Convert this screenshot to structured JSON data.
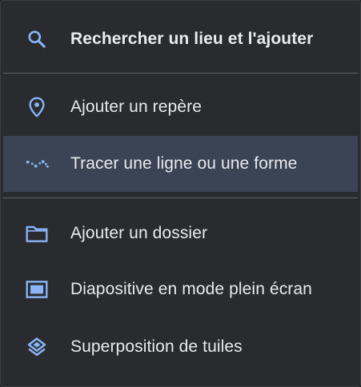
{
  "accent_color": "#8ab4f8",
  "menu": {
    "items": [
      {
        "label": "Rechercher un lieu et l'ajouter",
        "icon": "search-icon"
      },
      {
        "label": "Ajouter un repère",
        "icon": "location-pin-icon"
      },
      {
        "label": "Tracer une ligne ou une forme",
        "icon": "polyline-icon",
        "selected": true
      },
      {
        "label": "Ajouter un dossier",
        "icon": "folder-icon"
      },
      {
        "label": "Diapositive en mode plein écran",
        "icon": "slideshow-icon"
      },
      {
        "label": "Superposition de tuiles",
        "icon": "layers-icon"
      }
    ]
  }
}
